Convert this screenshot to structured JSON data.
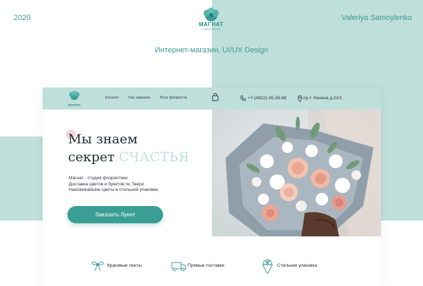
{
  "presentation": {
    "year": "2020",
    "author": "Valeriya Samoylenko",
    "subtitle": "Интернет-магазин, UI/UX Design",
    "logo_text": "МАГНАТ",
    "logo_sub": "студия флористики"
  },
  "site": {
    "logo_text": "МАГНАТ",
    "nav": [
      "Каталог",
      "Как заказать",
      "Блог флориста"
    ],
    "phone": "+7-(4822)-45-36-88",
    "address": "пр-т Ленина д.23/1",
    "hero": {
      "title_line1": "Мы знаем",
      "title_line2_a": "секрет",
      "title_line2_b": "СЧАСТЬЯ",
      "desc_line1": "Магнат - студия флористики",
      "desc_line2": "Доставка цветов и букетов по Твери",
      "desc_line3": "Наисвежайшие цветы в стильной упаковке",
      "cta": "Заказать букет"
    },
    "features": [
      {
        "icon": "ribbon-icon",
        "label": "Красивые ленты"
      },
      {
        "icon": "truck-icon",
        "label": "Прямые поставки"
      },
      {
        "icon": "bouquet-icon",
        "label": "Стильная упаковка"
      }
    ]
  },
  "colors": {
    "accent": "#3a9e94",
    "mint": "#bfdfdb",
    "text_dark": "#1f2b33"
  }
}
